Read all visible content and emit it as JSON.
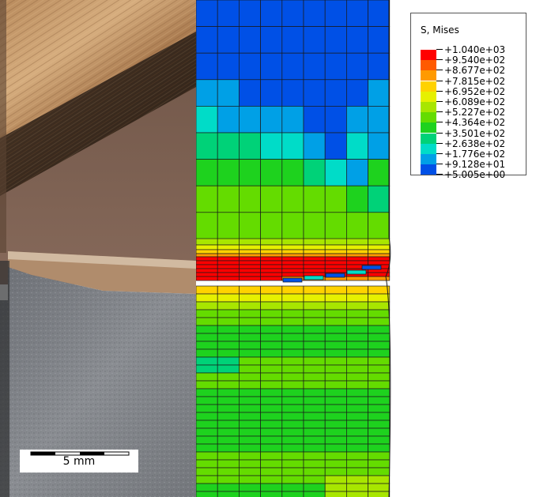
{
  "legend": {
    "title": "S, Mises",
    "entries": [
      {
        "label": "+1.040e+03",
        "color": "#ff0000"
      },
      {
        "label": "+9.540e+02",
        "color": "#ff5a00"
      },
      {
        "label": "+8.677e+02",
        "color": "#ff9a00"
      },
      {
        "label": "+7.815e+02",
        "color": "#ffd200"
      },
      {
        "label": "+6.952e+02",
        "color": "#e6f000"
      },
      {
        "label": "+6.089e+02",
        "color": "#a8e600"
      },
      {
        "label": "+5.227e+02",
        "color": "#64dc00"
      },
      {
        "label": "+4.364e+02",
        "color": "#1ed21e"
      },
      {
        "label": "+3.501e+02",
        "color": "#00d278"
      },
      {
        "label": "+2.638e+02",
        "color": "#00dcc8"
      },
      {
        "label": "+1.776e+02",
        "color": "#00a0e6"
      },
      {
        "label": "+9.128e+01",
        "color": "#0050e6"
      },
      {
        "label": "+5.005e+00",
        "color": "#0000e6"
      }
    ]
  },
  "scale_bar": {
    "label": "5 mm"
  },
  "colors": {
    "mesh_line": "#1a1a1a",
    "photo_wood_light": "#c79a6a",
    "photo_wood_dark": "#3a2a1e",
    "photo_brown": "#7a5f4e",
    "photo_steel": "#7d8085"
  }
}
